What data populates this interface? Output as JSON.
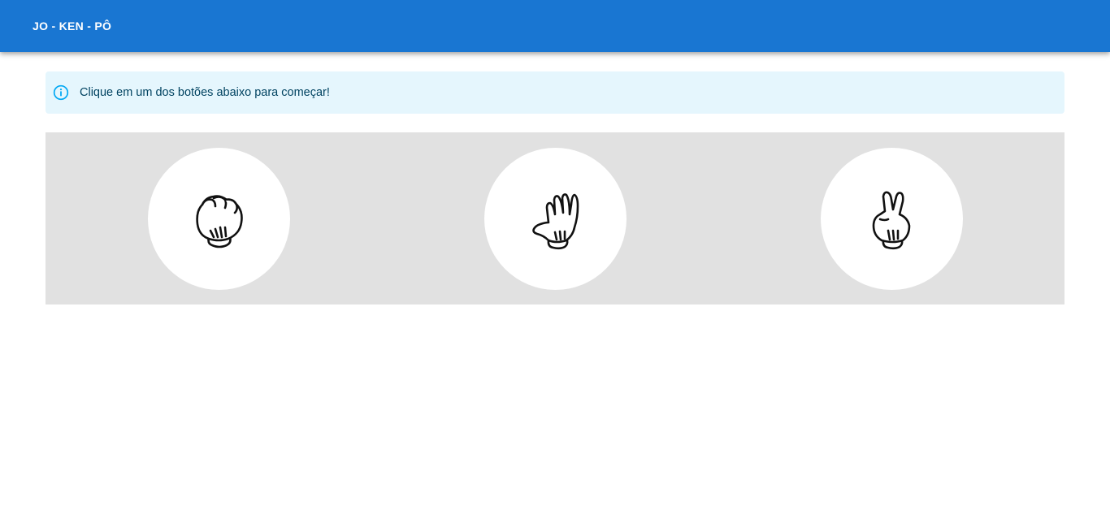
{
  "appbar": {
    "title": "JO - KEN - PÔ",
    "color": "#1976d2"
  },
  "alert": {
    "icon": "info-outline-icon",
    "text": "Clique em um dos botões abaixo para começar!",
    "background": "#e5f6fd",
    "icon_color": "#03a9f4"
  },
  "choices": {
    "panel_background": "#e1e1e1",
    "items": [
      {
        "id": "rock",
        "icon": "fist-glove-icon"
      },
      {
        "id": "paper",
        "icon": "open-hand-glove-icon"
      },
      {
        "id": "scissors",
        "icon": "peace-sign-glove-icon"
      }
    ]
  }
}
